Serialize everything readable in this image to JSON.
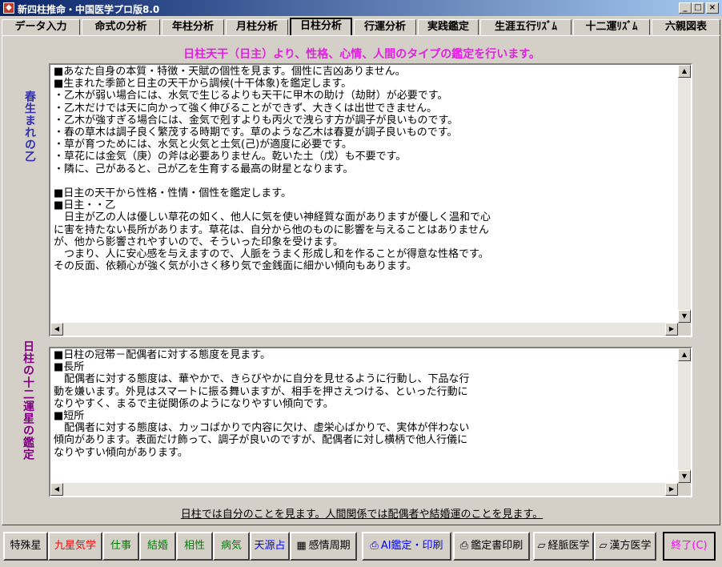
{
  "window": {
    "title": "新四柱推命・中国医学プロ版8.0",
    "icon": "app-icon"
  },
  "colors": {
    "heading": "#e020e0",
    "label": "#3030b0",
    "label2": "#800080",
    "exit": "#ff00ff"
  },
  "tabs": [
    {
      "label": "データ入力"
    },
    {
      "label": "命式の分析"
    },
    {
      "label": "年柱分析"
    },
    {
      "label": "月柱分析"
    },
    {
      "label": "日柱分析",
      "active": true
    },
    {
      "label": "行運分析"
    },
    {
      "label": "実践鑑定"
    },
    {
      "label": "生涯五行ﾘｽﾞﾑ"
    },
    {
      "label": "十二運ﾘｽﾞﾑ"
    },
    {
      "label": "六親図表"
    }
  ],
  "main": {
    "heading": "日柱天干（日主）より、性格、心情、人間のタイプの鑑定を行います。",
    "section1_label": "春生まれの乙",
    "section2_label": "日柱の十二運星の鑑定",
    "text1": "■あなた自身の本質・特徴・天賦の個性を見ます。個性に吉凶ありません。\n■生まれた季節と日主の天干から調候(十干体象)を鑑定します。\n・乙木が弱い場合には、水気で生じるよりも天干に甲木の助け（劫財）が必要です。\n・乙木だけでは天に向かって強く伸びることができず、大きくは出世できません。\n・乙木が強すぎる場合には、金気で剋すよりも丙火で洩らす方が調子が良いものです。\n・春の草木は調子良く繁茂する時期です。草のような乙木は春夏が調子良いものです。\n・草が育つためには、水気と火気と土気(己)が適度に必要です。\n・草花には金気（庚）の斧は必要ありません。乾いた土（戊）も不要です。\n・隣に、己があると、己が乙を生育する最高の財星となります。\n\n■日主の天干から性格・性情・個性を鑑定します。\n■日主・・乙\n　日主が乙の人は優しい草花の如く、他人に気を使い神経質な面がありますが優しく温和で心\nに害を持たない長所があります。草花は、自分から他のものに影響を与えることはありません\nが、他から影響されやすいので、そういった印象を受けます。\n　つまり、人に安心感を与えますので、人脈をうまく形成し和を作ることが得意な性格です。\nその反面、依頼心が強く気が小さく移り気で金銭面に細かい傾向もあります。",
    "text2": "■日柱の冠帯－配偶者に対する態度を見ます。\n■長所\n　配偶者に対する態度は、華やかで、きらびやかに自分を見せるように行動し、下品な行\n動を嫌います。外見はスマートに振る舞いますが、相手を押さえつける、といった行動に\nなりやすく、まるで主従関係のようになりやすい傾向です。\n■短所\n　配偶者に対する態度は、カッコばかりで内容に欠け、虚栄心ばかりで、実体が伴わない\n傾向があります。表面だけ飾って、調子が良いのですが、配偶者に対し横柄で他人行儀に\nなりやすい傾向があります。",
    "note": "日柱では自分のことを見ます。人間関係では配偶者や結婚運のことを見ます。"
  },
  "bottom_buttons": [
    {
      "label": "特殊星",
      "color": "#000000"
    },
    {
      "label": "九星気学",
      "color": "#ff0000"
    },
    {
      "label": "仕事",
      "color": "#008000"
    },
    {
      "label": "結婚",
      "color": "#008000"
    },
    {
      "label": "相性",
      "color": "#008000"
    },
    {
      "label": "病気",
      "color": "#008000"
    },
    {
      "label": "天源占",
      "color": "#0000ff"
    },
    {
      "label": "感情周期",
      "color": "#000000",
      "icon": "calendar-icon"
    },
    {
      "label": "AI鑑定・印刷",
      "color": "#0000ff",
      "icon": "printer-icon"
    },
    {
      "label": "鑑定書印刷",
      "color": "#000000",
      "icon": "printer-icon"
    },
    {
      "label": "経脈医学",
      "color": "#000000",
      "icon": "car-icon"
    },
    {
      "label": "漢方医学",
      "color": "#000000",
      "icon": "car-icon"
    },
    {
      "label": "終了(C)",
      "color": "#ff00ff"
    }
  ]
}
